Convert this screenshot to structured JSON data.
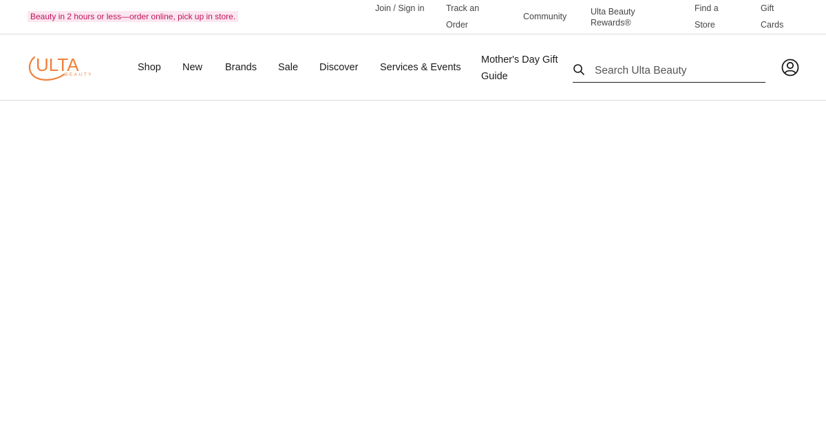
{
  "promo": {
    "text": "Beauty in 2 hours or less—order online, pick up in store."
  },
  "utility_nav": {
    "join_sign_in": "Join / Sign in",
    "track_order": "Track an Order",
    "community": "Community",
    "rewards": "Ulta Beauty Rewards®",
    "find_store": "Find a Store",
    "gift_cards": "Gift Cards"
  },
  "brand": {
    "logo_text": "ULTA",
    "logo_subtext": "BEAUTY",
    "color": "#f0803c"
  },
  "main_nav": {
    "shop": "Shop",
    "new": "New",
    "brands": "Brands",
    "sale": "Sale",
    "discover": "Discover",
    "services_events": "Services & Events",
    "mothers_day": "Mother's Day Gift Guide"
  },
  "search": {
    "placeholder": "Search Ulta Beauty",
    "value": ""
  },
  "icons": {
    "search": "search-icon",
    "account": "account-icon"
  },
  "colors": {
    "promo_text": "#c0105e",
    "promo_bg": "#fbe7ef",
    "divider": "#d9d9d9"
  }
}
